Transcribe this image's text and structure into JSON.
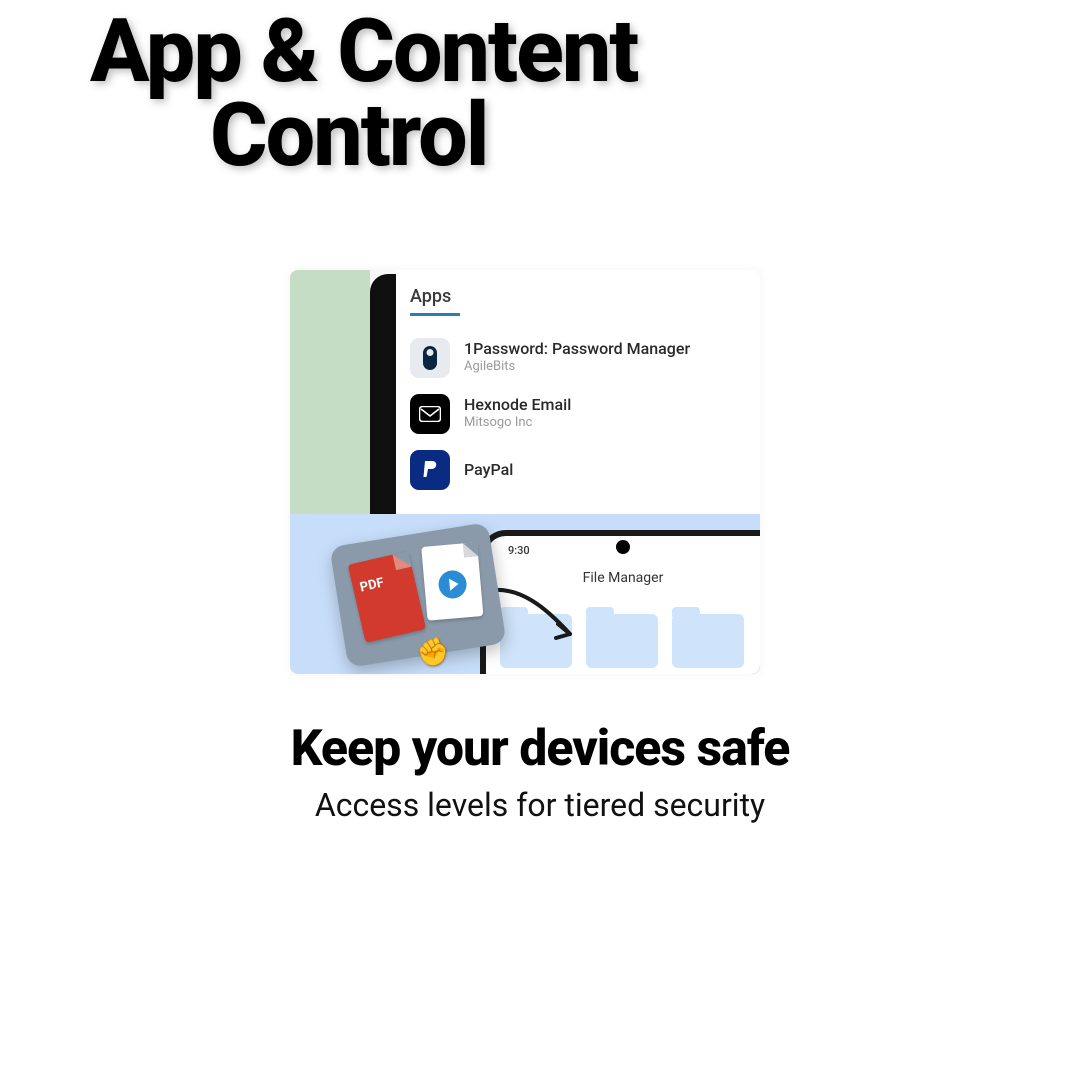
{
  "title": {
    "line1": "App & Content",
    "line2": "Control"
  },
  "apps_panel": {
    "tab_label": "Apps",
    "items": [
      {
        "name": "1Password: Password Manager",
        "vendor": "AgileBits"
      },
      {
        "name": "Hexnode Email",
        "vendor": "Mitsogo Inc"
      },
      {
        "name": "PayPal",
        "vendor": ""
      }
    ]
  },
  "phone": {
    "time": "9:30",
    "app_title": "File Manager"
  },
  "pdf_label": "PDF",
  "footer": {
    "heading": "Keep your devices safe",
    "subtext": "Access levels for tiered security"
  }
}
